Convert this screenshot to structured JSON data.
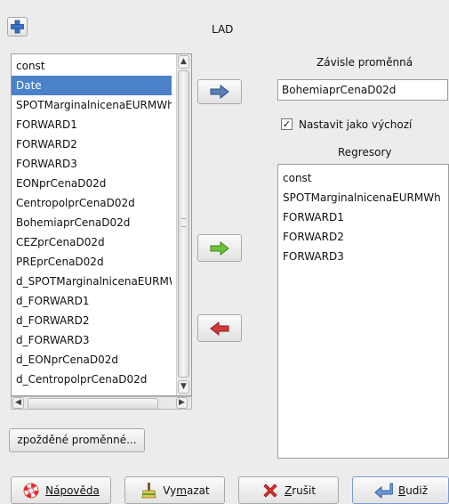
{
  "window": {
    "title": "LAD"
  },
  "toolbar": {
    "add_icon": "plus-icon"
  },
  "variables": {
    "items": [
      "const",
      "Date",
      "SPOTMarginalnicenaEURMWh",
      "FORWARD1",
      "FORWARD2",
      "FORWARD3",
      "EONprCenaD02d",
      "CentropolprCenaD02d",
      "BohemiaprCenaD02d",
      "CEZprCenaD02d",
      "PREprCenaD02d",
      "d_SPOTMarginalnicenaEURMWh",
      "d_FORWARD1",
      "d_FORWARD2",
      "d_FORWARD3",
      "d_EONprCenaD02d",
      "d_CentropolprCenaD02d"
    ],
    "selected": "Date"
  },
  "dependent": {
    "label": "Závisle proměnná",
    "value": "BohemiaprCenaD02d",
    "default_checkbox": {
      "label": "Nastavit jako výchozí",
      "checked": true
    }
  },
  "regressors": {
    "label": "Regresory",
    "items": [
      "const",
      "SPOTMarginalnicenaEURMWh",
      "FORWARD1",
      "FORWARD2",
      "FORWARD3"
    ]
  },
  "lags_button": {
    "label": "zpožděné proměnné..."
  },
  "buttons": {
    "help": "Nápověda",
    "clear_pre": "Vy",
    "clear_u": "m",
    "clear_post": "azat",
    "cancel_u": "Z",
    "cancel_post": "rušit",
    "ok_u": "B",
    "ok_post": "udiž"
  },
  "colors": {
    "selection": "#4a81c8",
    "arrow_dependent": "#5a7fb7",
    "arrow_add": "#6fc13c",
    "arrow_remove": "#d23a3a"
  }
}
